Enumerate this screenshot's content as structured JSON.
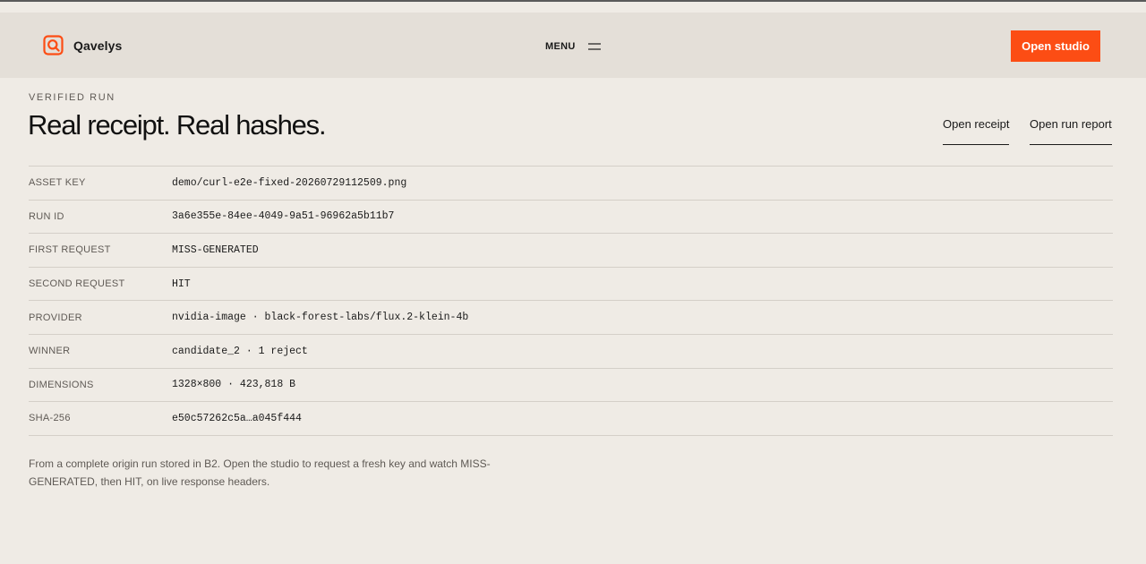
{
  "header": {
    "brand_name": "Qavelys",
    "menu_label": "MENU",
    "cta_label": "Open studio"
  },
  "hero": {
    "eyebrow": "VERIFIED RUN",
    "title": "Real receipt. Real hashes.",
    "links": [
      "Open receipt",
      "Open run report"
    ]
  },
  "details": [
    {
      "label": "ASSET KEY",
      "value": "demo/curl-e2e-fixed-20260729112509.png"
    },
    {
      "label": "RUN ID",
      "value": "3a6e355e-84ee-4049-9a51-96962a5b11b7"
    },
    {
      "label": "FIRST REQUEST",
      "value": "MISS-GENERATED"
    },
    {
      "label": "SECOND REQUEST",
      "value": "HIT"
    },
    {
      "label": "PROVIDER",
      "value": "nvidia-image · black-forest-labs/flux.2-klein-4b"
    },
    {
      "label": "WINNER",
      "value": "candidate_2 · 1 reject"
    },
    {
      "label": "DIMENSIONS",
      "value": "1328×800 · 423,818 B"
    },
    {
      "label": "SHA-256",
      "value": "e50c57262c5a…a045f444"
    }
  ],
  "footnote": "From a complete origin run stored in B2. Open the studio to request a fresh key and watch MISS-GENERATED, then HIT, on live response headers.",
  "colors": {
    "accent": "#fc4d14",
    "background": "#efebe5",
    "header_background": "#e4dfd8"
  },
  "icons": {
    "brand": "brand-logo-icon",
    "menu": "hamburger-menu-icon"
  }
}
